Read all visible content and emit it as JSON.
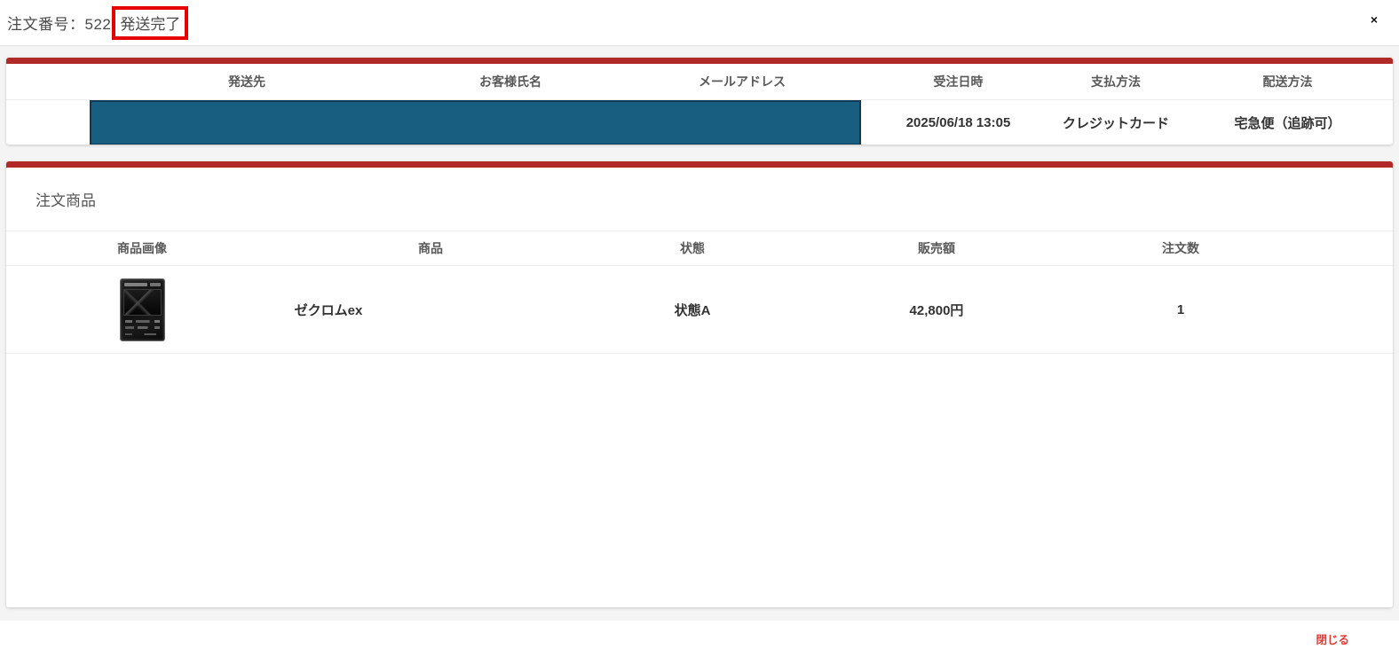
{
  "header": {
    "order_label": "注文番号：522",
    "status_badge": "発送完了",
    "close_icon": "×"
  },
  "order_info": {
    "columns": [
      "",
      "発送先",
      "お客様氏名",
      "メールアドレス",
      "受注日時",
      "支払方法",
      "配送方法"
    ],
    "row": {
      "order_datetime": "2025/06/18 13:05",
      "payment_method": "クレジットカード",
      "shipping_method": "宅急便（追跡可）"
    }
  },
  "items_section": {
    "title": "注文商品",
    "columns": [
      "商品画像",
      "商品",
      "状態",
      "販売額",
      "注文数"
    ],
    "rows": [
      {
        "name": "ゼクロムex",
        "condition": "状態A",
        "price": "42,800円",
        "quantity": "1"
      }
    ]
  },
  "footer": {
    "close_label": "閉じる"
  },
  "colors": {
    "section_bar_red": "#b22a27",
    "status_highlight_red": "#e60000",
    "redaction_teal": "#175e80",
    "close_link_red": "#e53935",
    "body_background": "#f4f4f4"
  }
}
